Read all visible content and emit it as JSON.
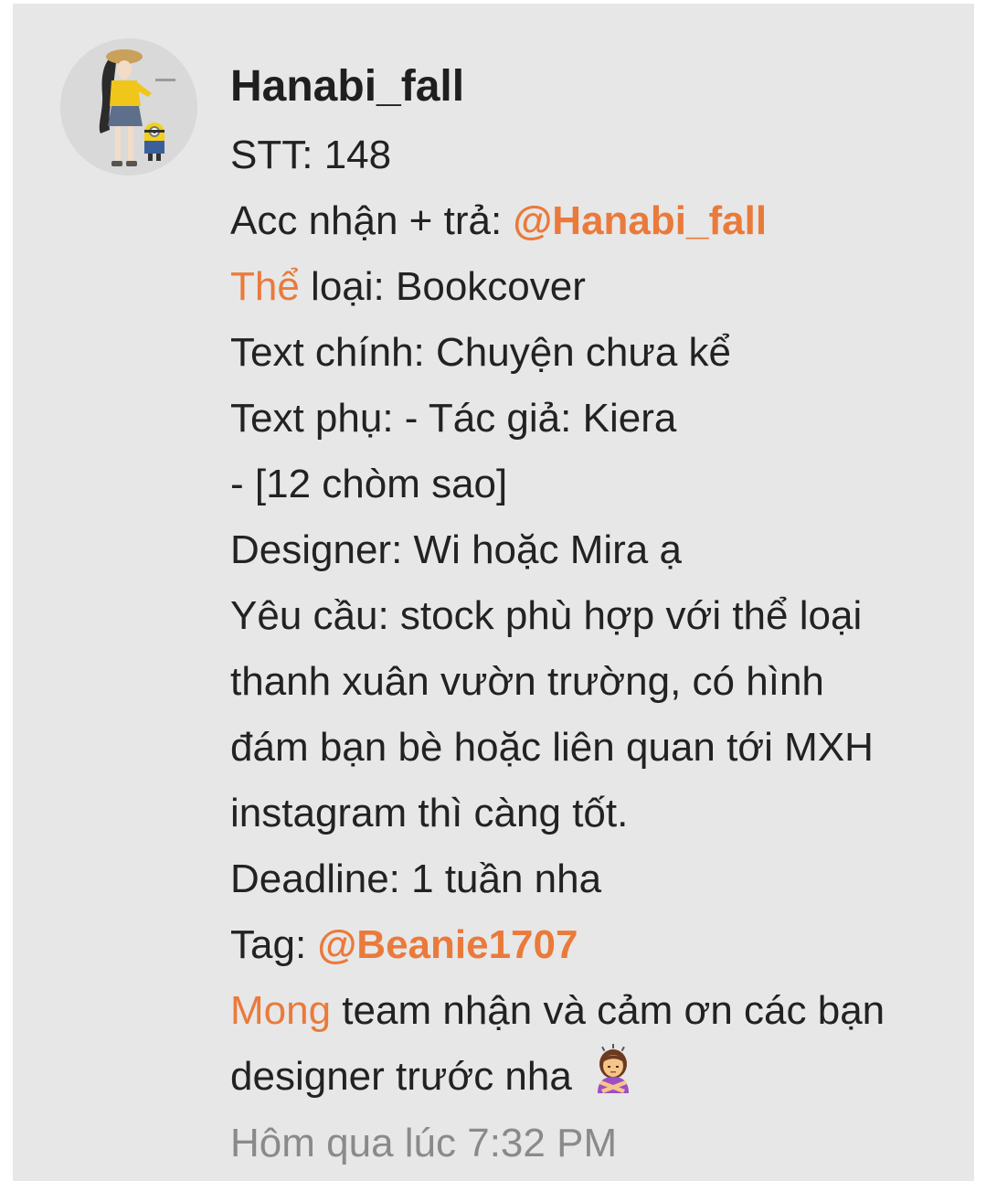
{
  "user": {
    "name": "Hanabi_fall",
    "avatar_icon": "anime-girl-avatar-icon"
  },
  "message": {
    "stt_label": "STT: ",
    "stt_value": "148",
    "acc_label": "Acc nhận + trả: ",
    "acc_mention": "@Hanabi_fall",
    "genre_prefix": "Thể",
    "genre_rest": " loại: Bookcover",
    "main_text": "Text chính: Chuyện chưa kể",
    "sub_text_1": "Text phụ: - Tác giả: Kiera",
    "sub_text_2": "- [12 chòm sao]",
    "designer": "Designer: Wi hoặc Mira ạ",
    "request_1": "Yêu cầu: stock phù hợp với thể loại",
    "request_2": "thanh xuân vườn trường, có hình",
    "request_3": "đám bạn bè hoặc liên quan tới MXH",
    "request_4": "instagram thì càng tốt.",
    "deadline": "Deadline: 1 tuần nha",
    "tag_label": "Tag: ",
    "tag_mention": "@Beanie1707",
    "closing_prefix": "Mong",
    "closing_rest": " team nhận và cảm ơn các bạn",
    "closing_2": "designer trước nha",
    "closing_emoji_icon": "person-gesturing-no-emoji-icon"
  },
  "timestamp": "Hôm qua lúc 7:32 PM",
  "colors": {
    "accent": "#ea7a3b",
    "background": "#e7e7e7",
    "text": "#222222",
    "muted": "#8a8a8a"
  }
}
